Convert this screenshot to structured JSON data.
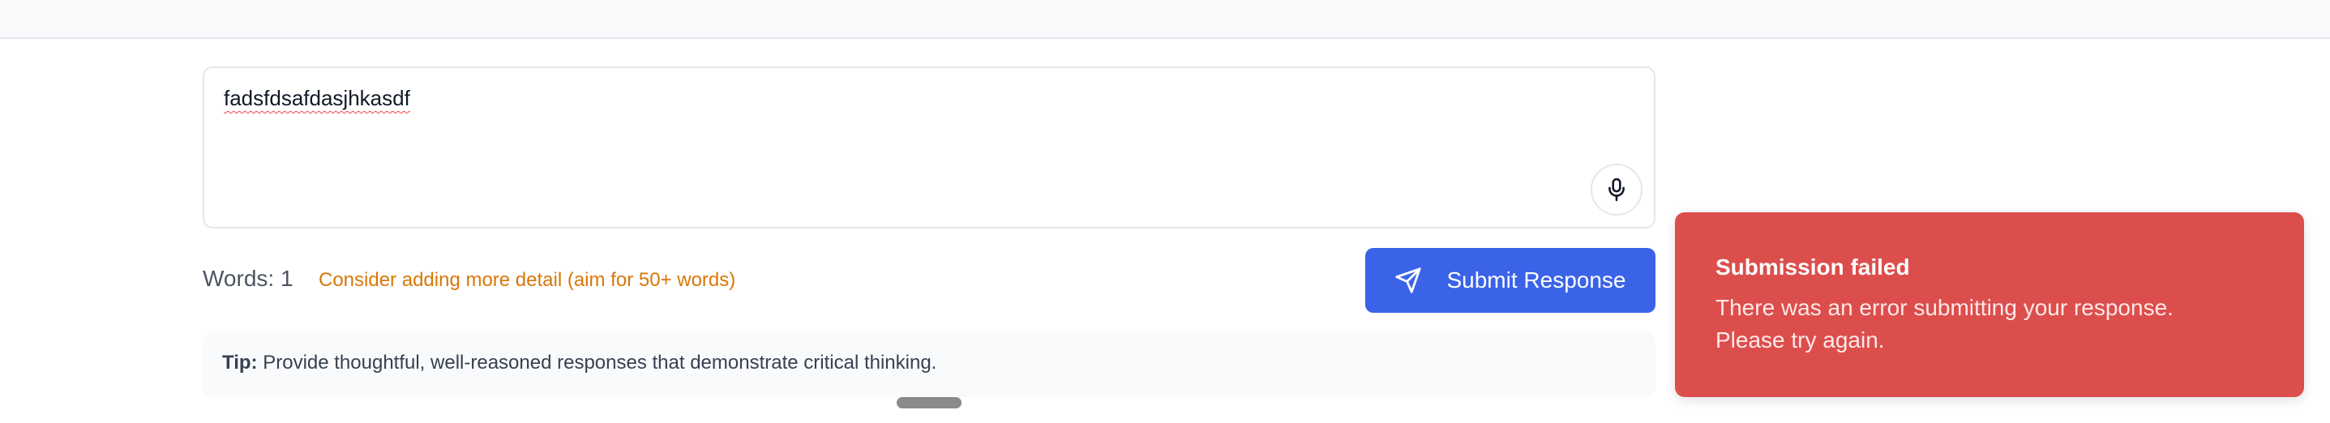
{
  "editor": {
    "value": "fadsfdsafdasjhkasdf"
  },
  "stats": {
    "words_label": "Words: 1",
    "hint": "Consider adding more detail (aim for 50+ words)"
  },
  "submit": {
    "label": "Submit Response"
  },
  "tip": {
    "prefix": "Tip:",
    "text": " Provide thoughtful, well-reasoned responses that demonstrate critical thinking."
  },
  "toast": {
    "title": "Submission failed",
    "message": "There was an error submitting your response. Please try again."
  },
  "colors": {
    "primary": "#3b63e8",
    "error": "#dc4e4c",
    "warning": "#d97706"
  },
  "icons": {
    "mic": "microphone-icon",
    "send": "send-icon"
  }
}
